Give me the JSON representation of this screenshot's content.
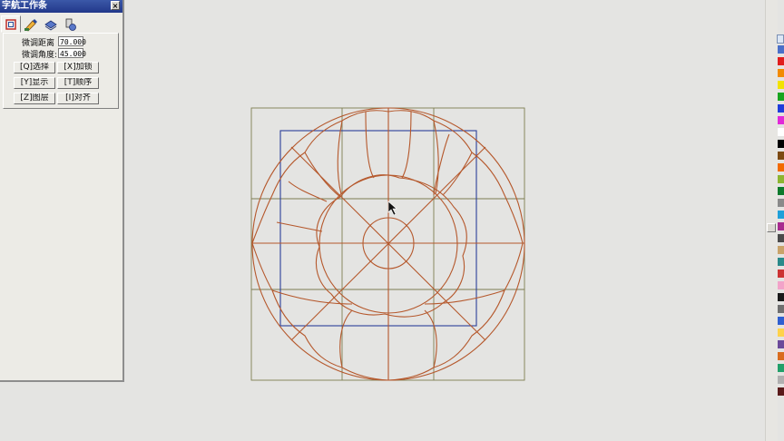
{
  "panel": {
    "title": "字航工作条",
    "close_glyph": "×",
    "tabs": [
      {
        "icon": "frame-icon"
      },
      {
        "icon": "pencil-brush-icon"
      },
      {
        "icon": "layer-stack-icon"
      },
      {
        "icon": "tools-icon"
      }
    ],
    "fields": [
      {
        "label": "微调距离",
        "value": "70.000"
      },
      {
        "label": "微调角度:",
        "value": "45.000"
      }
    ],
    "buttons": [
      "[Q]选择",
      "[X]加锁",
      "[Y]显示",
      "[T]顺序",
      "[Z]图层",
      "[I]对齐"
    ]
  },
  "palette": {
    "swatches": [
      "#4a6fc9",
      "#e11d1d",
      "#f28a00",
      "#f2e200",
      "#18a51f",
      "#1f3ddb",
      "#e12ad8",
      "#ffffff",
      "#000000",
      "#7d4a13",
      "#f26a00",
      "#8db531",
      "#0d7a2c",
      "#8a8a8a",
      "#1fa0d9",
      "#a82b8f",
      "#4a4a4a",
      "#c9a36a",
      "#2a8a8a",
      "#cc3333",
      "#f2a3c9",
      "#1a1a1a",
      "#6f6f6f",
      "#2f5fd0",
      "#ffd24a",
      "#6b4a9a",
      "#d96c1f",
      "#22a06a",
      "#b0b0b0",
      "#5a1a1a"
    ]
  }
}
